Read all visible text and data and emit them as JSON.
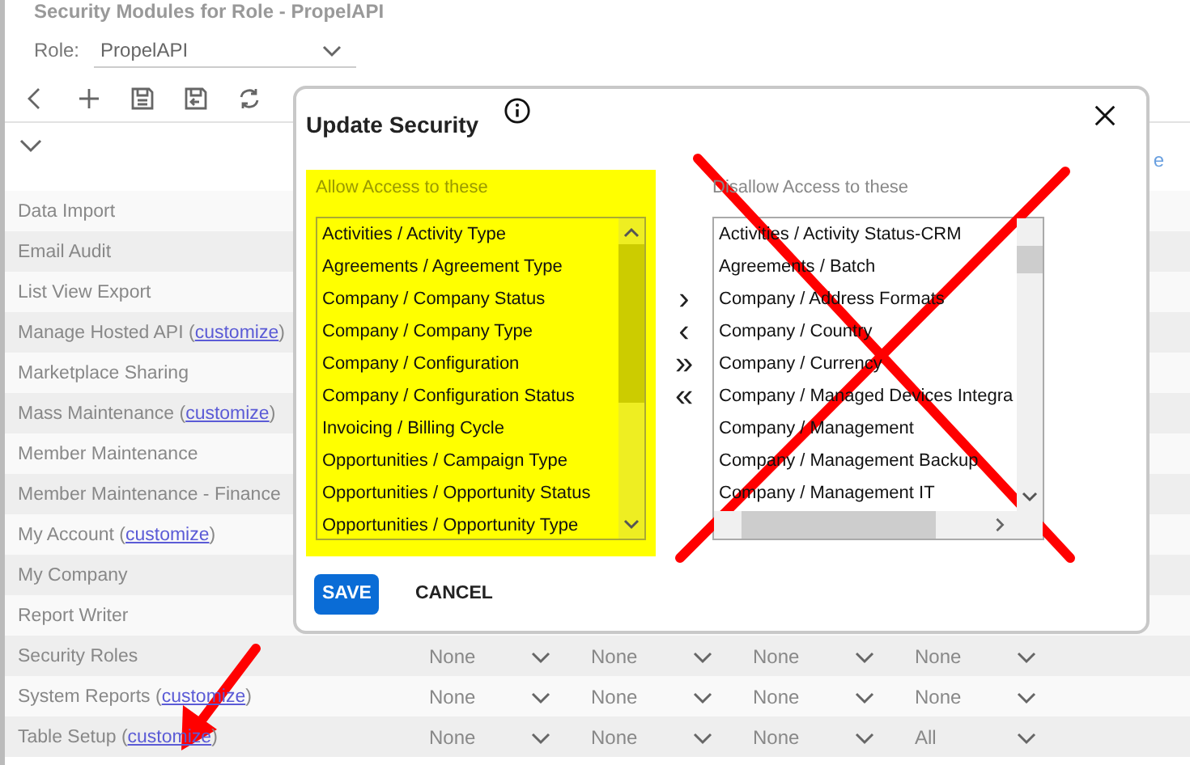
{
  "page": {
    "title": "Security Modules for Role - PropelAPI",
    "role": {
      "label": "Role:",
      "value": "PropelAPI"
    },
    "header_fragment": "e"
  },
  "modules": [
    {
      "name": "Data Import"
    },
    {
      "name": "Email Audit"
    },
    {
      "name": "List View Export"
    },
    {
      "name": "Manage Hosted API",
      "link_open": "(",
      "link": "customize",
      "link_close": ")"
    },
    {
      "name": "Marketplace Sharing"
    },
    {
      "name": "Mass Maintenance",
      "link_open": "(",
      "link": "customize",
      "link_close": ")"
    },
    {
      "name": "Member Maintenance"
    },
    {
      "name": "Member Maintenance - Finance"
    },
    {
      "name": "My Account",
      "link_open": "(",
      "link": "customize",
      "link_close": ")"
    },
    {
      "name": "My Company"
    },
    {
      "name": "Report Writer"
    },
    {
      "name": "Security Roles",
      "permissions": [
        "None",
        "None",
        "None",
        "None"
      ]
    },
    {
      "name": "System Reports",
      "link_open": "(",
      "link": "customize",
      "link_close": ")",
      "permissions": [
        "None",
        "None",
        "None",
        "None"
      ]
    },
    {
      "name": "Table Setup",
      "link_open": "(",
      "link": "customize",
      "link_close": ")",
      "permissions": [
        "None",
        "None",
        "None",
        "All"
      ]
    }
  ],
  "dialog": {
    "title": "Update Security",
    "allow": {
      "label": "Allow Access to these",
      "highlighted": true,
      "items": [
        "Activities / Activity Type",
        "Agreements / Agreement Type",
        "Company / Company Status",
        "Company / Company Type",
        "Company / Configuration",
        "Company / Configuration Status",
        "Invoicing / Billing Cycle",
        "Opportunities / Campaign Type",
        "Opportunities / Opportunity Status",
        "Opportunities / Opportunity Type"
      ]
    },
    "move_buttons": [
      "›",
      "‹",
      "»",
      "«"
    ],
    "disallow": {
      "label": "Disallow Access to these",
      "crossed_out": true,
      "items": [
        "Activities / Activity Status-CRM",
        "Agreements / Batch",
        "Company / Address Formats",
        "Company / Country",
        "Company / Currency",
        "Company / Managed Devices Integra",
        "Company / Management",
        "Company / Management Backup",
        "Company / Management IT"
      ]
    },
    "buttons": [
      {
        "label": "SAVE",
        "kind": "primary"
      },
      {
        "label": "CANCEL",
        "kind": "plain"
      }
    ]
  }
}
